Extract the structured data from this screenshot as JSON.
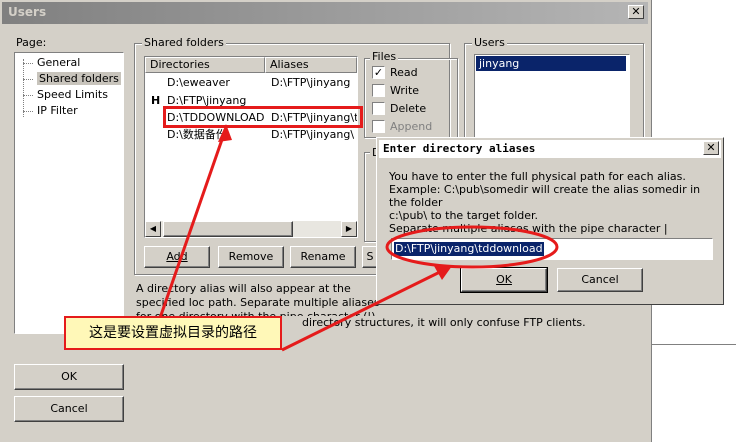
{
  "window": {
    "title": "Users",
    "close_glyph": "✕"
  },
  "page_group": {
    "label": "Page:",
    "items": [
      "General",
      "Shared folders",
      "Speed Limits",
      "IP Filter"
    ],
    "selected": "Shared folders"
  },
  "shared": {
    "label": "Shared folders",
    "headers": [
      "Directories",
      "Aliases"
    ],
    "rows": [
      {
        "home": "",
        "dir": "D:\\eweaver",
        "alias": "D:\\FTP\\jinyang"
      },
      {
        "home": "H",
        "dir": "D:\\FTP\\jinyang",
        "alias": ""
      },
      {
        "home": "",
        "dir": "D:\\TDDOWNLOAD",
        "alias": "D:\\FTP\\jinyang\\t"
      },
      {
        "home": "",
        "dir": "D:\\数据备份",
        "alias": "D:\\FTP\\jinyang\\"
      }
    ],
    "buttons": {
      "add": "Add",
      "remove": "Remove",
      "rename": "Rename",
      "set": "S"
    },
    "info": "A directory alias will also appear at the specified loc path. Separate multiple aliases for one directory with the pipe character (|)",
    "info2": "directory structures, it will only confuse FTP clients."
  },
  "files": {
    "label": "Files",
    "items": [
      {
        "label": "Read",
        "checked": true
      },
      {
        "label": "Write",
        "checked": false
      },
      {
        "label": "Delete",
        "checked": false
      },
      {
        "label": "Append",
        "checked": false
      }
    ],
    "group2_label": "D"
  },
  "users": {
    "label": "Users",
    "items": [
      "jinyang"
    ]
  },
  "main_buttons": {
    "ok": "OK",
    "cancel": "Cancel"
  },
  "dialog": {
    "title": "Enter directory aliases",
    "close_glyph": "✕",
    "lines": [
      "You have to enter the full physical path for each alias.",
      "Example: C:\\pub\\somedir will create the alias somedir in the folder",
      "c:\\pub\\ to the target folder.",
      "Separate multiple aliases with the pipe character |"
    ],
    "input_value": "D:\\FTP\\jinyang\\tddownload",
    "ok": "OK",
    "cancel": "Cancel"
  },
  "annotation": {
    "text": "这是要设置虚拟目录的路径"
  },
  "colors": {
    "highlight_red": "#e51b1b",
    "callout_fill": "#fff8b8",
    "selection": "#0a246a"
  }
}
